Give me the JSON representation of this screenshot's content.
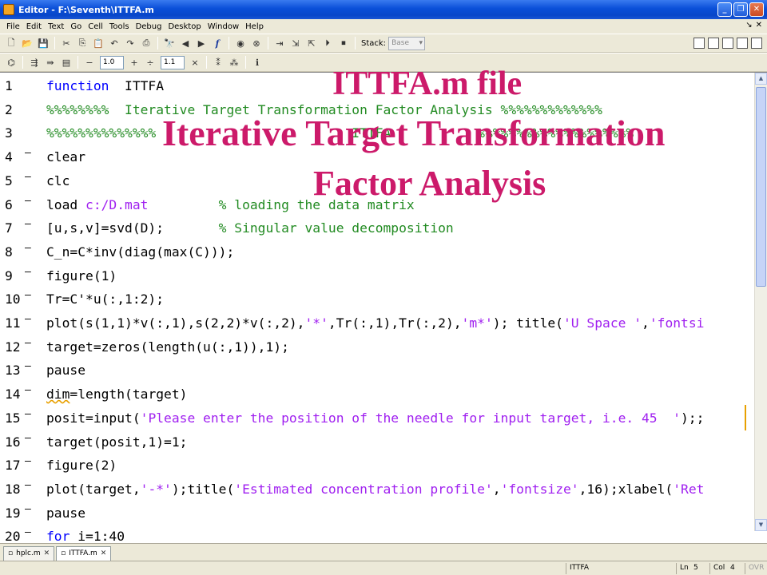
{
  "window": {
    "title": "Editor - F:\\Seventh\\ITTFA.m"
  },
  "menu": [
    "File",
    "Edit",
    "Text",
    "Go",
    "Cell",
    "Tools",
    "Debug",
    "Desktop",
    "Window",
    "Help"
  ],
  "toolbar": {
    "stack_label": "Stack:",
    "stack_value": "Base"
  },
  "cell_toolbar": {
    "decrement_value": "1.0",
    "increment_value": "1.1"
  },
  "overlay": {
    "line1": "ITTFA.m file",
    "line2": "Iterative Target Transformation",
    "line3": "Factor Analysis"
  },
  "code": [
    {
      "num": "1",
      "dash": false,
      "parts": [
        {
          "t": "kw",
          "v": "function"
        },
        {
          "t": "ident",
          "v": "  ITTFA"
        }
      ]
    },
    {
      "num": "2",
      "dash": false,
      "parts": [
        {
          "t": "cm",
          "v": "%%%%%%%%  Iterative Target Transformation Factor Analysis %%%%%%%%%%%%%"
        }
      ]
    },
    {
      "num": "3",
      "dash": false,
      "parts": [
        {
          "t": "cm",
          "v": "%%%%%%%%%%%%%%                         ITTFA           %%%%%%%%%%%%%%%%%%%%"
        }
      ]
    },
    {
      "num": "4",
      "dash": true,
      "parts": [
        {
          "t": "ident",
          "v": "clear"
        }
      ]
    },
    {
      "num": "5",
      "dash": true,
      "parts": [
        {
          "t": "ident",
          "v": "clc"
        }
      ]
    },
    {
      "num": "6",
      "dash": true,
      "parts": [
        {
          "t": "ident",
          "v": "load "
        },
        {
          "t": "str",
          "v": "c:/D.mat"
        },
        {
          "t": "ident",
          "v": "         "
        },
        {
          "t": "cm",
          "v": "% loading the data matrix"
        }
      ]
    },
    {
      "num": "7",
      "dash": true,
      "parts": [
        {
          "t": "ident",
          "v": "[u,s,v]=svd(D);       "
        },
        {
          "t": "cm",
          "v": "% Singular value decomposition"
        }
      ]
    },
    {
      "num": "8",
      "dash": true,
      "parts": [
        {
          "t": "ident",
          "v": "C_n=C*inv(diag(max(C)));"
        }
      ]
    },
    {
      "num": "9",
      "dash": true,
      "parts": [
        {
          "t": "ident",
          "v": "figure(1)"
        }
      ]
    },
    {
      "num": "10",
      "dash": true,
      "parts": [
        {
          "t": "ident",
          "v": "Tr=C'*u(:,1:2);"
        }
      ]
    },
    {
      "num": "11",
      "dash": true,
      "parts": [
        {
          "t": "ident",
          "v": "plot(s(1,1)*v(:,1),s(2,2)*v(:,2),"
        },
        {
          "t": "str",
          "v": "'*'"
        },
        {
          "t": "ident",
          "v": ",Tr(:,1),Tr(:,2),"
        },
        {
          "t": "str",
          "v": "'m*'"
        },
        {
          "t": "ident",
          "v": "); title("
        },
        {
          "t": "str",
          "v": "'U Space '"
        },
        {
          "t": "ident",
          "v": ","
        },
        {
          "t": "str",
          "v": "'fontsi"
        }
      ]
    },
    {
      "num": "12",
      "dash": true,
      "parts": [
        {
          "t": "ident",
          "v": "target=zeros(length(u(:,1)),1);"
        }
      ]
    },
    {
      "num": "13",
      "dash": true,
      "parts": [
        {
          "t": "ident",
          "v": "pause"
        }
      ]
    },
    {
      "num": "14",
      "dash": true,
      "parts": [
        {
          "t": "sq",
          "v": "dim"
        },
        {
          "t": "ident",
          "v": "=length(target)"
        }
      ]
    },
    {
      "num": "15",
      "dash": true,
      "parts": [
        {
          "t": "ident",
          "v": "posit=input("
        },
        {
          "t": "str",
          "v": "'Please enter the position of the needle for input target, i.e. 45  '"
        },
        {
          "t": "ident",
          "v": ");;"
        }
      ]
    },
    {
      "num": "16",
      "dash": true,
      "parts": [
        {
          "t": "ident",
          "v": "target(posit,1)=1;"
        }
      ]
    },
    {
      "num": "17",
      "dash": true,
      "parts": [
        {
          "t": "ident",
          "v": "figure(2)"
        }
      ]
    },
    {
      "num": "18",
      "dash": true,
      "parts": [
        {
          "t": "ident",
          "v": "plot(target,"
        },
        {
          "t": "str",
          "v": "'-*'"
        },
        {
          "t": "ident",
          "v": ");title("
        },
        {
          "t": "str",
          "v": "'Estimated concentration profile'"
        },
        {
          "t": "ident",
          "v": ","
        },
        {
          "t": "str",
          "v": "'fontsize'"
        },
        {
          "t": "ident",
          "v": ",16);xlabel("
        },
        {
          "t": "str",
          "v": "'Ret"
        }
      ]
    },
    {
      "num": "19",
      "dash": true,
      "parts": [
        {
          "t": "ident",
          "v": "pause"
        }
      ]
    },
    {
      "num": "20",
      "dash": true,
      "parts": [
        {
          "t": "kw",
          "v": "for"
        },
        {
          "t": "ident",
          "v": " i=1:40"
        }
      ]
    }
  ],
  "tabs": [
    {
      "label": "hplc.m",
      "active": false
    },
    {
      "label": "ITTFA.m",
      "active": true
    }
  ],
  "status": {
    "function": "ITTFA",
    "ln_label": "Ln",
    "ln": "5",
    "col_label": "Col",
    "col": "4",
    "ovr": "OVR"
  }
}
